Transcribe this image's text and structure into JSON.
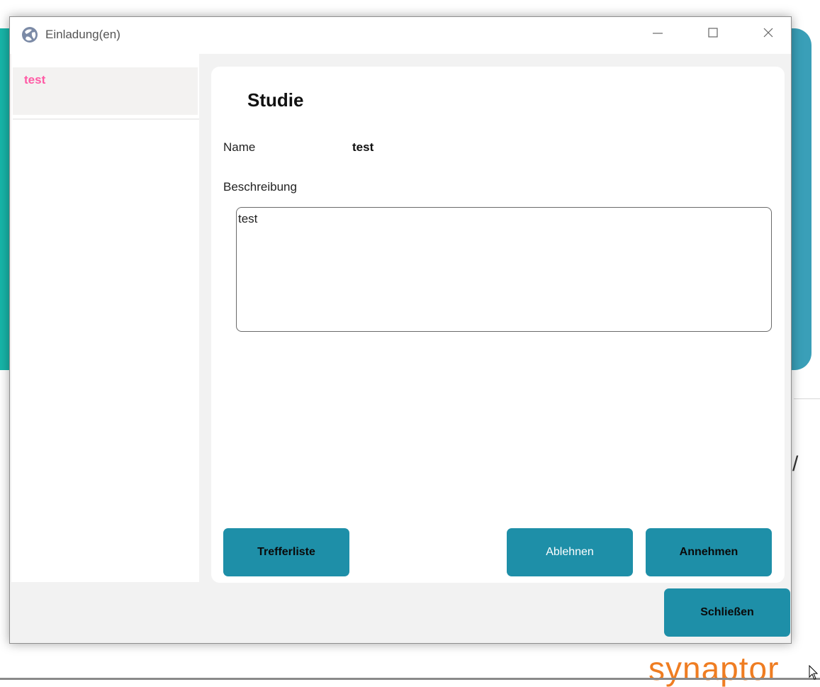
{
  "window": {
    "title": "Einladung(en)",
    "controls": {
      "minimize": "minimize-icon",
      "maximize": "maximize-icon",
      "close": "close-icon"
    }
  },
  "sidebar": {
    "items": [
      {
        "label": "test"
      }
    ]
  },
  "study": {
    "heading": "Studie",
    "name_label": "Name",
    "name_value": "test",
    "description_label": "Beschreibung",
    "description_value": "test"
  },
  "buttons": {
    "trefferliste": "Trefferliste",
    "ablehnen": "Ablehnen",
    "annehmen": "Annehmen",
    "schliessen": "Schließen"
  },
  "background": {
    "brand_text": "synaptor",
    "partial_char": "/"
  },
  "colors": {
    "accent": "#1e8fa8",
    "selected_item_text": "#ff5aa5",
    "brand": "#ef7d22",
    "teal_panel": "#17b5a8"
  }
}
